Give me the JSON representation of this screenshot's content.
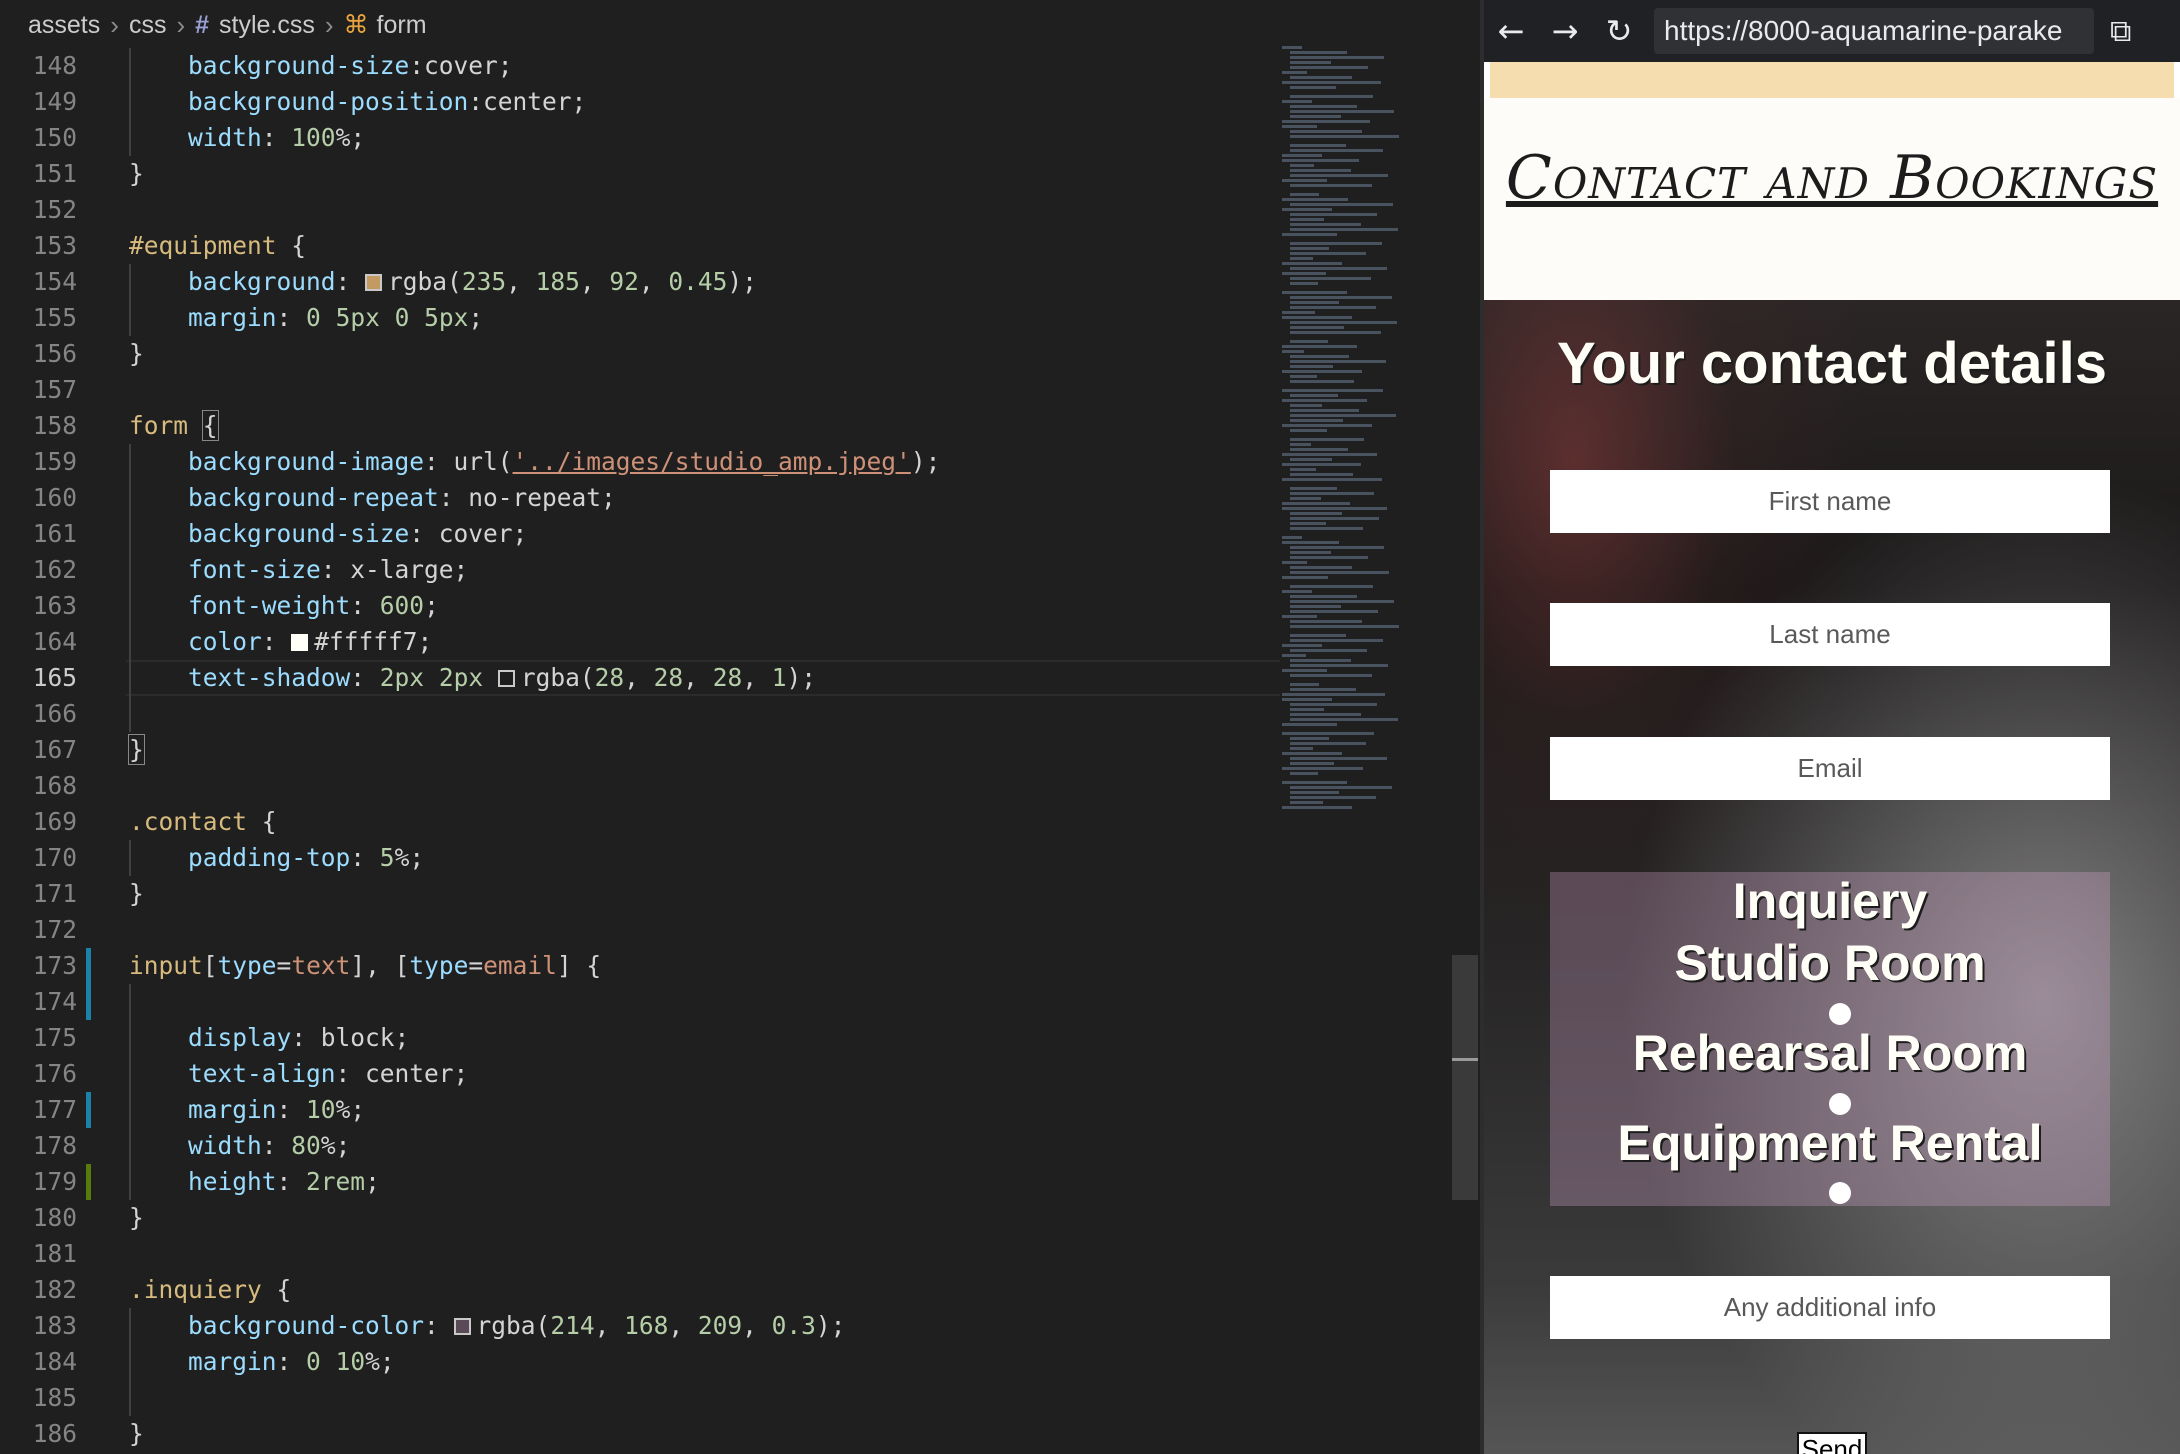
{
  "breadcrumb": {
    "items": [
      "assets",
      "css",
      "style.css",
      "form"
    ]
  },
  "editor": {
    "active_line": 165,
    "lines": [
      {
        "n": 148,
        "text": "    background-size:cover;"
      },
      {
        "n": 149,
        "text": "    background-position:center;"
      },
      {
        "n": 150,
        "text": "    width: 100%;"
      },
      {
        "n": 151,
        "text": "}"
      },
      {
        "n": 152,
        "text": ""
      },
      {
        "n": 153,
        "text": "#equipment {"
      },
      {
        "n": 154,
        "text": "    background: rgba(235, 185, 92, 0.45);"
      },
      {
        "n": 155,
        "text": "    margin: 0 5px 0 5px;"
      },
      {
        "n": 156,
        "text": "}"
      },
      {
        "n": 157,
        "text": ""
      },
      {
        "n": 158,
        "text": "form {"
      },
      {
        "n": 159,
        "text": "    background-image: url('../images/studio_amp.jpeg');"
      },
      {
        "n": 160,
        "text": "    background-repeat: no-repeat;"
      },
      {
        "n": 161,
        "text": "    background-size: cover;"
      },
      {
        "n": 162,
        "text": "    font-size: x-large;"
      },
      {
        "n": 163,
        "text": "    font-weight: 600;"
      },
      {
        "n": 164,
        "text": "    color: #fffff7;"
      },
      {
        "n": 165,
        "text": "    text-shadow: 2px 2px rgba(28, 28, 28, 1);"
      },
      {
        "n": 166,
        "text": ""
      },
      {
        "n": 167,
        "text": "}"
      },
      {
        "n": 168,
        "text": ""
      },
      {
        "n": 169,
        "text": ".contact {"
      },
      {
        "n": 170,
        "text": "    padding-top: 5%;"
      },
      {
        "n": 171,
        "text": "}"
      },
      {
        "n": 172,
        "text": ""
      },
      {
        "n": 173,
        "text": "input[type=text], [type=email] {"
      },
      {
        "n": 174,
        "text": ""
      },
      {
        "n": 175,
        "text": "    display: block;"
      },
      {
        "n": 176,
        "text": "    text-align: center;"
      },
      {
        "n": 177,
        "text": "    margin: 10%;"
      },
      {
        "n": 178,
        "text": "    width: 80%;"
      },
      {
        "n": 179,
        "text": "    height: 2rem;"
      },
      {
        "n": 180,
        "text": "}"
      },
      {
        "n": 181,
        "text": ""
      },
      {
        "n": 182,
        "text": ".inquiery {"
      },
      {
        "n": 183,
        "text": "    background-color: rgba(214, 168, 209, 0.3);"
      },
      {
        "n": 184,
        "text": "    margin: 0 10%;"
      },
      {
        "n": 185,
        "text": ""
      },
      {
        "n": 186,
        "text": "}"
      }
    ],
    "swatches": {
      "equipment": "#c39a62",
      "color": "#fffff7",
      "shadow": "#1c1c1c",
      "inquiery": "#5a4a58"
    },
    "colors": {
      "selector": "#d7ba7d",
      "property": "#9cdcfe",
      "number": "#b5cea8",
      "string": "#ce9178",
      "modified_gutter": "#1b81a8",
      "added_gutter": "#587c0c"
    }
  },
  "browser": {
    "back_icon": "←",
    "forward_icon": "→",
    "reload_icon": "↻",
    "url": "https://8000-aquamarine-parake",
    "open_external_icon": "⧉",
    "page_title": "Contact and Bookings",
    "form_title": "Your contact details",
    "first_name_placeholder": "First name",
    "last_name_placeholder": "Last name",
    "email_placeholder": "Email",
    "inquiry_heading": "Inquiery",
    "options": [
      "Studio Room",
      "Rehearsal Room",
      "Equipment Rental"
    ],
    "additional_info_placeholder": "Any additional info",
    "send_label": "Send"
  }
}
